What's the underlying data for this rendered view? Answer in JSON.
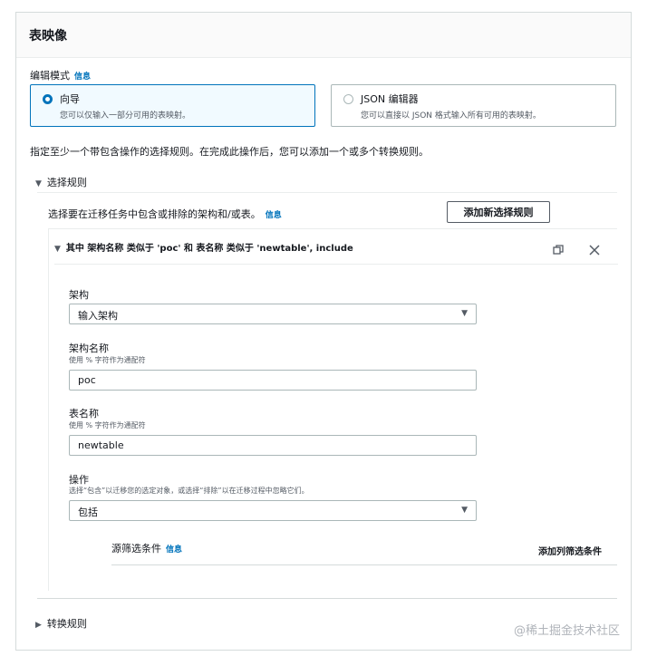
{
  "panel": {
    "title": "表映像"
  },
  "edit_mode": {
    "label": "编辑模式",
    "info": "信息",
    "options": [
      {
        "title": "向导",
        "desc": "您可以仅输入一部分可用的表映射。",
        "selected": true
      },
      {
        "title": "JSON 编辑器",
        "desc": "您可以直接以 JSON 格式输入所有可用的表映射。",
        "selected": false
      }
    ]
  },
  "instruction": "指定至少一个带包含操作的选择规则。在完成此操作后，您可以添加一个或多个转换规则。",
  "selection_rules": {
    "heading": "选择规则",
    "desc": "选择要在迁移任务中包含或排除的架构和/或表。",
    "info": "信息",
    "add_button": "添加新选择规则",
    "rule": {
      "summary": "其中 架构名称 类似于 'poc' 和 表名称 类似于 'newtable', include",
      "schema": {
        "label": "架构",
        "value": "输入架构"
      },
      "schema_name": {
        "label": "架构名称",
        "hint": "使用 % 字符作为通配符",
        "value": "poc"
      },
      "table_name": {
        "label": "表名称",
        "hint": "使用 % 字符作为通配符",
        "value": "newtable"
      },
      "action": {
        "label": "操作",
        "hint": "选择“包含”以迁移您的选定对象，或选择“排除”以在迁移过程中忽略它们。",
        "value": "包括"
      },
      "source_filter": {
        "title": "源筛选条件",
        "info": "信息",
        "add_label": "添加列筛选条件"
      }
    }
  },
  "transformation_rules": {
    "heading": "转换规则"
  },
  "watermark": "@稀土掘金技术社区",
  "colors": {
    "accent": "#0073bb",
    "border": "#aab7b8",
    "selected_bg": "#f1faff"
  }
}
